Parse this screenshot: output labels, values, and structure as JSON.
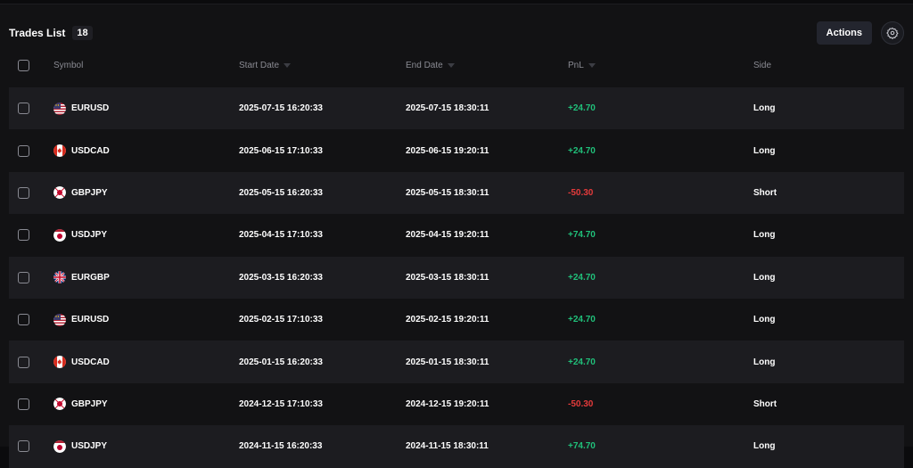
{
  "header": {
    "title": "Trades List",
    "count": "18",
    "actions_label": "Actions",
    "settings_icon": "gear-icon"
  },
  "columns": {
    "symbol": "Symbol",
    "start_date": "Start Date",
    "end_date": "End Date",
    "pnl": "PnL",
    "side": "Side"
  },
  "colors": {
    "positive": "#20c07a",
    "negative": "#e53b3b",
    "background": "#121214",
    "row_alt": "#1c1c20"
  },
  "rows": [
    {
      "symbol": "EURUSD",
      "flag": "eu-us",
      "start": "2025-07-15 16:20:33",
      "end": "2025-07-15 18:30:11",
      "pnl": "+24.70",
      "pnl_sign": "pos",
      "side": "Long"
    },
    {
      "symbol": "USDCAD",
      "flag": "us-ca",
      "start": "2025-06-15 17:10:33",
      "end": "2025-06-15 19:20:11",
      "pnl": "+24.70",
      "pnl_sign": "pos",
      "side": "Long"
    },
    {
      "symbol": "GBPJPY",
      "flag": "gb-jp",
      "start": "2025-05-15 16:20:33",
      "end": "2025-05-15 18:30:11",
      "pnl": "-50.30",
      "pnl_sign": "neg",
      "side": "Short"
    },
    {
      "symbol": "USDJPY",
      "flag": "us-jp",
      "start": "2025-04-15 17:10:33",
      "end": "2025-04-15 19:20:11",
      "pnl": "+74.70",
      "pnl_sign": "pos",
      "side": "Long"
    },
    {
      "symbol": "EURGBP",
      "flag": "eu-gb",
      "start": "2025-03-15 16:20:33",
      "end": "2025-03-15 18:30:11",
      "pnl": "+24.70",
      "pnl_sign": "pos",
      "side": "Long"
    },
    {
      "symbol": "EURUSD",
      "flag": "eu-us",
      "start": "2025-02-15 17:10:33",
      "end": "2025-02-15 19:20:11",
      "pnl": "+24.70",
      "pnl_sign": "pos",
      "side": "Long"
    },
    {
      "symbol": "USDCAD",
      "flag": "us-ca",
      "start": "2025-01-15 16:20:33",
      "end": "2025-01-15 18:30:11",
      "pnl": "+24.70",
      "pnl_sign": "pos",
      "side": "Long"
    },
    {
      "symbol": "GBPJPY",
      "flag": "gb-jp",
      "start": "2024-12-15 17:10:33",
      "end": "2024-12-15 19:20:11",
      "pnl": "-50.30",
      "pnl_sign": "neg",
      "side": "Short"
    },
    {
      "symbol": "USDJPY",
      "flag": "us-jp",
      "start": "2024-11-15 16:20:33",
      "end": "2024-11-15 18:30:11",
      "pnl": "+74.70",
      "pnl_sign": "pos",
      "side": "Long"
    }
  ]
}
